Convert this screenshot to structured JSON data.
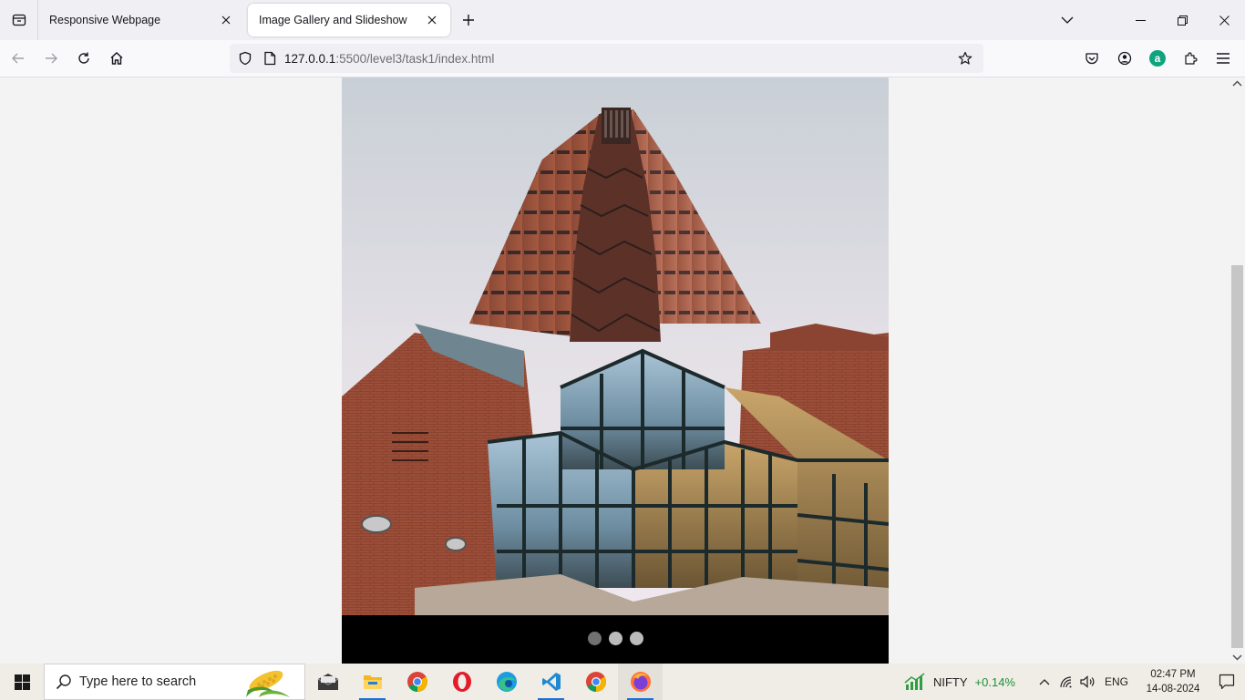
{
  "browser": {
    "tabs": [
      {
        "title": "Responsive Webpage",
        "active": false
      },
      {
        "title": "Image Gallery and Slideshow",
        "active": true
      }
    ],
    "url_host": "127.0.0.1",
    "url_rest": ":5500/level3/task1/index.html",
    "addon_letter": "a"
  },
  "page": {
    "slides_total": 3,
    "active_slide": 1,
    "colors": {
      "page_bg": "#f3f3f3",
      "slideshow_bg": "#000000",
      "dot": "#bbbbbb",
      "dot_active": "#717171"
    }
  },
  "taskbar": {
    "search_placeholder": "Type here to search",
    "apps": [
      "mail-icon",
      "file-explorer-icon",
      "chrome-icon",
      "opera-icon",
      "edge-icon",
      "vscode-icon",
      "chrome-icon",
      "firefox-icon"
    ],
    "nifty_label": "NIFTY",
    "nifty_change": "+0.14%",
    "language": "ENG",
    "time": "02:47 PM",
    "date": "14-08-2024"
  }
}
